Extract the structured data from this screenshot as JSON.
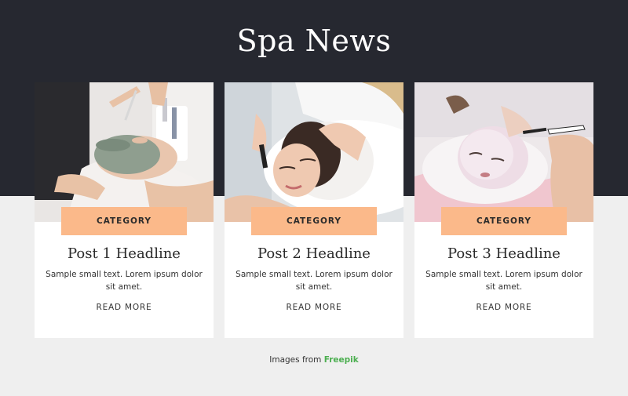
{
  "page": {
    "title": "Spa News"
  },
  "posts": [
    {
      "image_alt": "Woman receiving a clay face mask",
      "category": "CATEGORY",
      "headline": "Post 1 Headline",
      "excerpt": "Sample small text. Lorem ipsum dolor sit amet.",
      "read_more": "READ MORE"
    },
    {
      "image_alt": "Woman receiving a head massage and facial treatment",
      "category": "CATEGORY",
      "headline": "Post 2 Headline",
      "excerpt": "Sample small text. Lorem ipsum dolor sit amet.",
      "read_more": "READ MORE"
    },
    {
      "image_alt": "Woman getting a white face mask applied with a brush",
      "category": "CATEGORY",
      "headline": "Post 3 Headline",
      "excerpt": "Sample small text. Lorem ipsum dolor sit amet.",
      "read_more": "READ MORE"
    }
  ],
  "credit": {
    "prefix": "Images from ",
    "link_text": "Freepik"
  },
  "colors": {
    "hero_background": "#262830",
    "page_background": "#efefef",
    "badge": "#fbb98a",
    "credit_link": "#4caf50"
  }
}
